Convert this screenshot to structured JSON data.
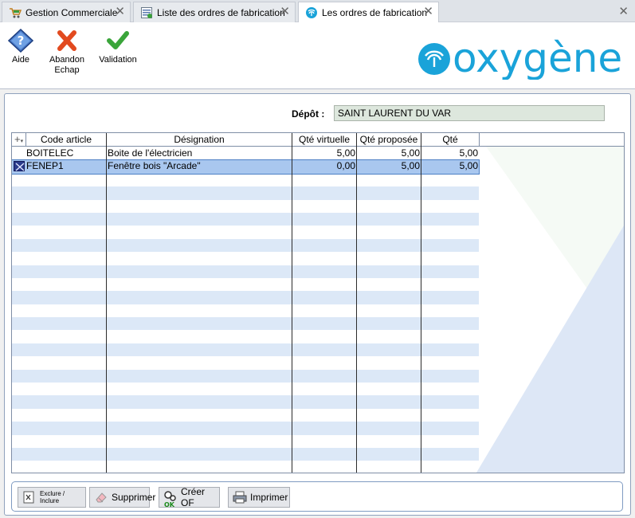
{
  "tabs": [
    {
      "label": "Gestion Commerciale",
      "icon": "cart-icon"
    },
    {
      "label": "Liste des ordres de fabrication",
      "icon": "list-icon"
    },
    {
      "label": "Les ordres de fabrication",
      "icon": "palm-icon",
      "active": true
    }
  ],
  "toolbar": {
    "aide": "Aide",
    "abandon_line1": "Abandon",
    "abandon_line2": "Echap",
    "validation": "Validation"
  },
  "logo": {
    "text": "oxygène",
    "color": "#1aa3d9"
  },
  "depot": {
    "label": "Dépôt :",
    "value": "SAINT LAURENT DU VAR"
  },
  "grid": {
    "add_symbol": "+",
    "columns": [
      "Code article",
      "Désignation",
      "Qté virtuelle",
      "Qté proposée",
      "Qté"
    ],
    "rows": [
      {
        "code": "BOITELEC",
        "designation": "Boite de l'électricien",
        "qte_virtuelle": "5,00",
        "qte_proposee": "5,00",
        "qte": "5,00"
      },
      {
        "code": "FENEP1",
        "designation": "Fenêtre bois \"Arcade\"",
        "qte_virtuelle": "0,00",
        "qte_proposee": "5,00",
        "qte": "5,00",
        "selected": true
      }
    ]
  },
  "buttons": {
    "exclure": "Exclure / Inclure",
    "supprimer": "Supprimer",
    "creer_of": "Créer OF",
    "imprimer": "Imprimer"
  },
  "colors": {
    "row_alt": "#dce8f7",
    "selected": "#a9c7ef",
    "depot_field": "#dde7dd"
  }
}
